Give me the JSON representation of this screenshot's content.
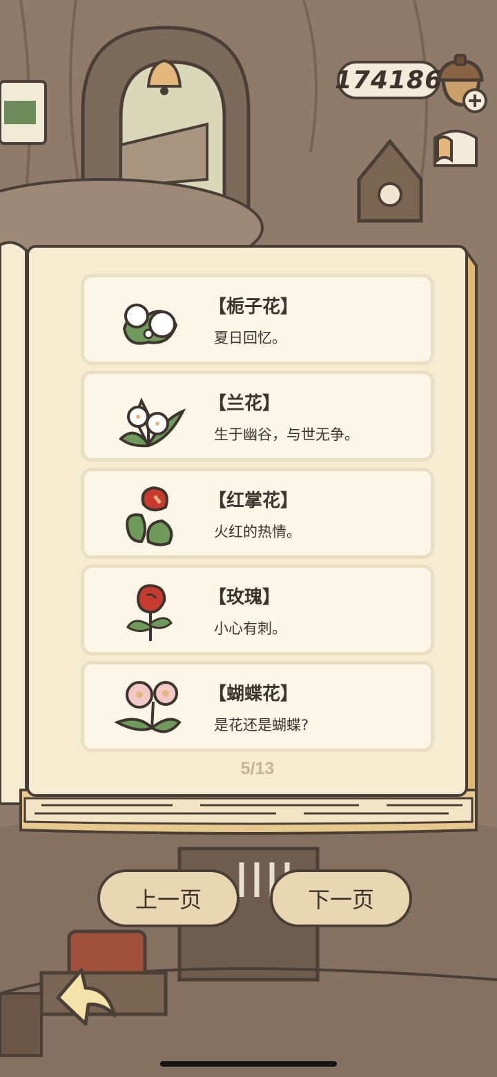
{
  "currency": {
    "amount": "174186",
    "icon": "acorn-icon",
    "add_icon": "plus-icon"
  },
  "shop": {
    "icon": "tent-shop-icon"
  },
  "flowers": [
    {
      "name": "【栀子花】",
      "desc": "夏日回忆。",
      "icon": "gardenia-icon"
    },
    {
      "name": "【兰花】",
      "desc": "生于幽谷，与世无争。",
      "icon": "orchid-icon"
    },
    {
      "name": "【红掌花】",
      "desc": "火红的热情。",
      "icon": "anthurium-icon"
    },
    {
      "name": "【玫瑰】",
      "desc": "小心有刺。",
      "icon": "rose-icon"
    },
    {
      "name": "【蝴蝶花】",
      "desc": "是花还是蝴蝶?",
      "icon": "phalaenopsis-icon"
    }
  ],
  "pagination": {
    "label": "5/13"
  },
  "nav": {
    "prev": "上一页",
    "next": "下一页"
  },
  "back": {
    "icon": "back-arrow-icon"
  },
  "colors": {
    "outline": "#4a3f36",
    "page": "#f6ecd2",
    "card": "#fbf6e7",
    "button": "#e9d7b1",
    "page_number": "#c8b398"
  }
}
